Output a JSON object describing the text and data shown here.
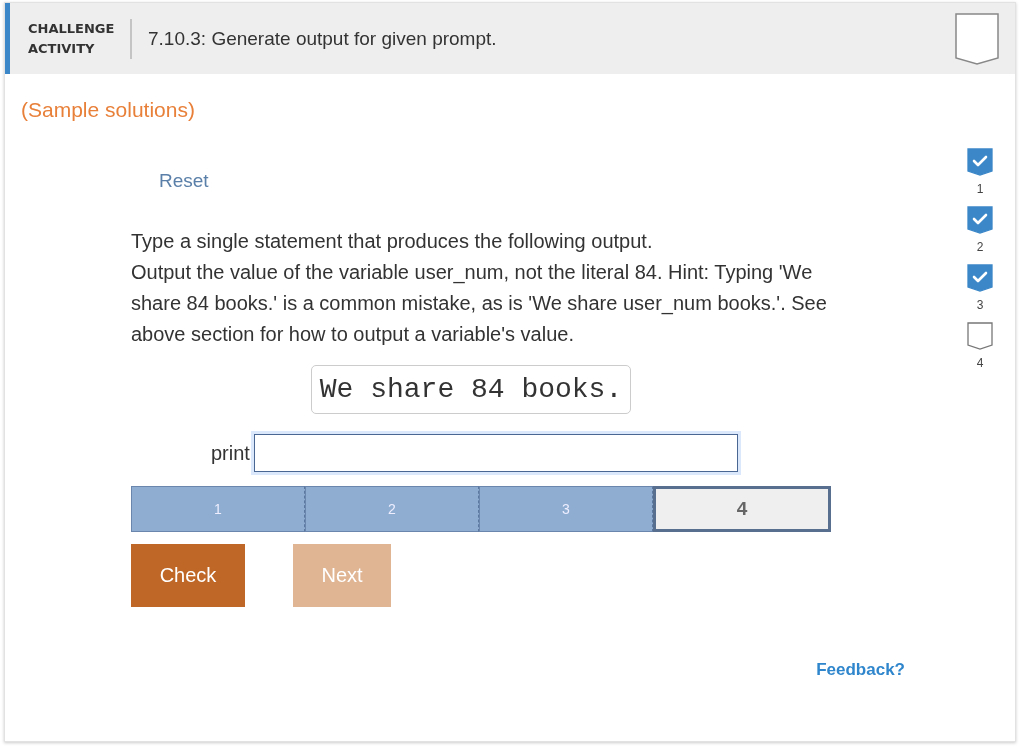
{
  "header": {
    "label": "CHALLENGE ACTIVITY",
    "title": "7.10.3: Generate output for given prompt.",
    "completed": false
  },
  "sample_link": "(Sample solutions)",
  "reset": "Reset",
  "prompt": "Type a single statement that produces the following output.",
  "hint": "Output the value of the variable user_num, not the literal 84. Hint: Typing 'We share 84 books.' is a common mistake, as is 'We share user_num books.'. See above section for how to output a variable's value.",
  "expected_output": "We share 84 books.",
  "code_prefix": "print",
  "steps": [
    {
      "label": "1",
      "done": true,
      "selected": false
    },
    {
      "label": "2",
      "done": true,
      "selected": false
    },
    {
      "label": "3",
      "done": true,
      "selected": false
    },
    {
      "label": "4",
      "done": false,
      "selected": true
    }
  ],
  "buttons": [
    {
      "label": "Check",
      "disabled": false
    },
    {
      "label": "Next",
      "disabled": true
    }
  ],
  "checkpoints": [
    {
      "label": "1",
      "checked": true
    },
    {
      "label": "2",
      "checked": true
    },
    {
      "label": "3",
      "checked": true
    },
    {
      "label": "4",
      "checked": false
    }
  ],
  "feedback": "Feedback?"
}
